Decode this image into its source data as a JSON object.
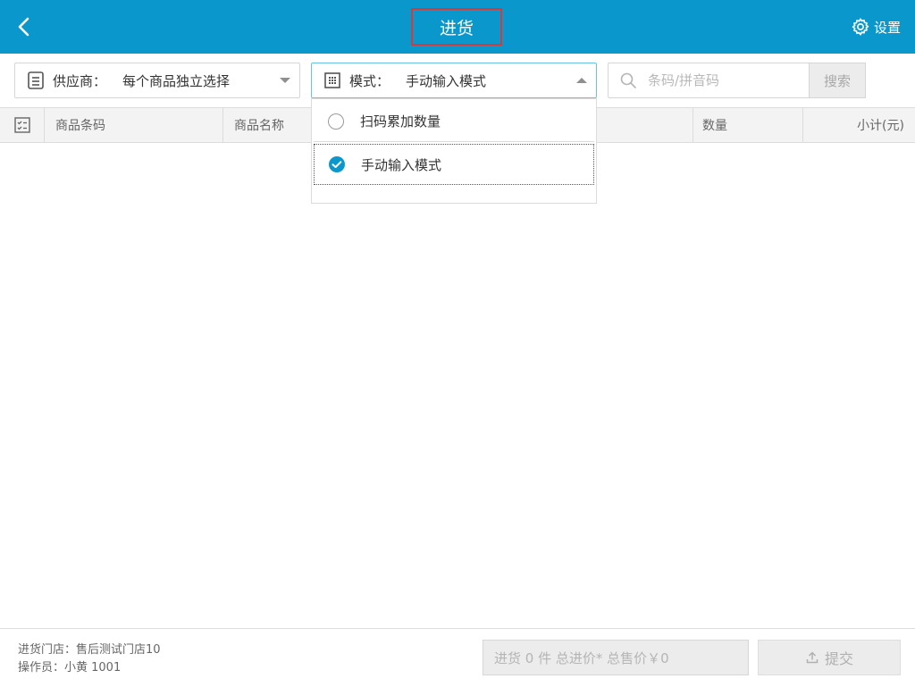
{
  "header": {
    "title": "进货",
    "settings_label": "设置"
  },
  "toolbar": {
    "supplier": {
      "label": "供应商：",
      "value": "每个商品独立选择"
    },
    "mode": {
      "label": "模式：",
      "value": "手动输入模式"
    },
    "search": {
      "placeholder": "条码/拼音码",
      "button_label": "搜索"
    }
  },
  "table": {
    "columns": [
      "商品条码",
      "商品名称",
      "数量",
      "小计(元)"
    ]
  },
  "mode_dropdown": {
    "options": [
      {
        "label": "扫码累加数量",
        "selected": false
      },
      {
        "label": "手动输入模式",
        "selected": true
      }
    ]
  },
  "footer": {
    "store": "进货门店：售后测试门店10",
    "operator": "操作员：小黄 1001",
    "summary": "进货 0 件 总进价* 总售价￥0",
    "submit_label": "提交"
  },
  "colors": {
    "accent": "#0a98cc",
    "title_outline": "#d33c3c"
  },
  "icons": [
    "back-icon",
    "gear-icon",
    "supplier-list-icon",
    "mode-grid-icon",
    "search-icon",
    "checklist-icon",
    "check-icon",
    "upload-icon"
  ]
}
